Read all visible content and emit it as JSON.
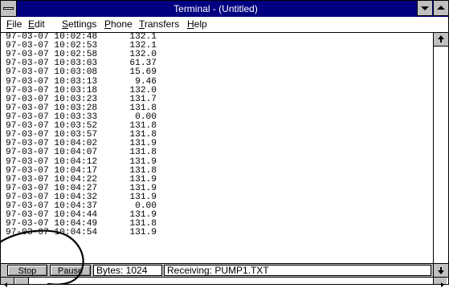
{
  "window": {
    "title": "Terminal - (Untitled)"
  },
  "menu": [
    {
      "hotkey": "F",
      "rest": "ile"
    },
    {
      "hotkey": "E",
      "rest": "dit"
    },
    {
      "hotkey": "S",
      "rest": "ettings"
    },
    {
      "hotkey": "P",
      "rest": "hone"
    },
    {
      "hotkey": "T",
      "rest": "ransfers"
    },
    {
      "hotkey": "H",
      "rest": "elp"
    }
  ],
  "terminal": {
    "lines": [
      "97-03-07 10:02:48      132.1",
      "97-03-07 10:02:53      132.1",
      "97-03-07 10:02:58      132.0",
      "97-03-07 10:03:03      61.37",
      "97-03-07 10:03:08      15.69",
      "97-03-07 10:03:13       9.46",
      "97-03-07 10:03:18      132.0",
      "97-03-07 10:03:23      131.7",
      "97-03-07 10:03:28      131.8",
      "97-03-07 10:03:33       0.00",
      "97-03-07 10:03:52      131.8",
      "97-03-07 10:03:57      131.8",
      "97-03-07 10:04:02      131.9",
      "97-03-07 10:04:07      131.8",
      "97-03-07 10:04:12      131.9",
      "97-03-07 10:04:17      131.8",
      "97-03-07 10:04:22      131.9",
      "97-03-07 10:04:27      131.9",
      "97-03-07 10:04:32      131.9",
      "97-03-07 10:04:37       0.00",
      "97-03-07 10:04:44      131.9",
      "97-03-07 10:04:49      131.8",
      "97-03-07 10:04:54      131.9"
    ]
  },
  "status": {
    "stop_label": "Stop",
    "pause_label": "Pause",
    "bytes": "Bytes: 1024",
    "receiving": "Receiving: PUMP1.TXT"
  },
  "icons": {
    "system_menu": "system-menu-icon",
    "minimize": "minimize-icon",
    "maximize": "maximize-icon",
    "scroll_up": "arrow-up-icon",
    "scroll_down": "arrow-down-icon",
    "scroll_left": "arrow-left-icon",
    "scroll_right": "arrow-right-icon"
  },
  "colors": {
    "titlebar": "#000080",
    "chrome": "#c0c0c0",
    "text": "#000000"
  }
}
